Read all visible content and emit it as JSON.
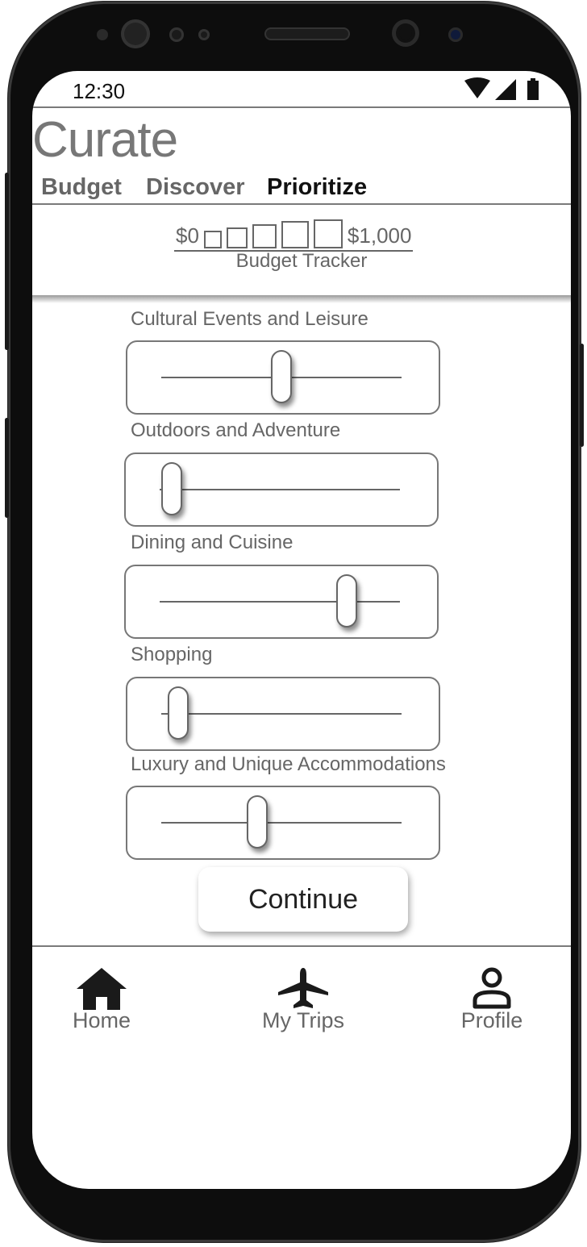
{
  "status_bar": {
    "time": "12:30"
  },
  "app": {
    "title": "Curate"
  },
  "tabs": [
    {
      "label": "Budget"
    },
    {
      "label": "Discover"
    },
    {
      "label": "Prioritize",
      "active": true
    }
  ],
  "budget_tracker": {
    "min_label": "$0",
    "max_label": "$1,000",
    "caption": "Budget Tracker"
  },
  "categories": [
    {
      "label": "Cultural Events and Leisure",
      "level": 0.5
    },
    {
      "label": "Outdoors and Adventure",
      "level": 0.05
    },
    {
      "label": "Dining and Cuisine",
      "level": 0.78
    },
    {
      "label": "Shopping",
      "level": 0.07
    },
    {
      "label": "Luxury and Unique Accommodations",
      "level": 0.4
    }
  ],
  "continue_button": {
    "label": "Continue"
  },
  "bottom_nav": [
    {
      "label": "Home",
      "icon": "home-icon"
    },
    {
      "label": "My Trips",
      "icon": "airplane-icon"
    },
    {
      "label": "Profile",
      "icon": "profile-icon"
    }
  ],
  "colors": {
    "text_muted": "#666666",
    "text_active": "#111111",
    "frame": "#0d0d0d"
  }
}
